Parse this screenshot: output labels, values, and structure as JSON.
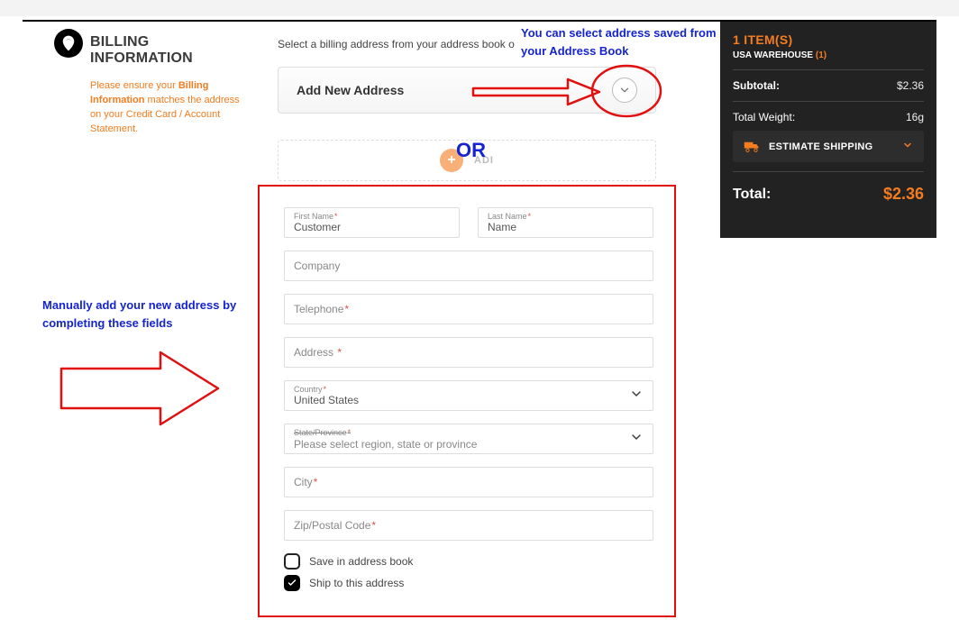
{
  "billing": {
    "heading": "BILLING INFORMATION",
    "hint_pre": "Please ensure your ",
    "hint_bold": "Billing Information",
    "hint_post": " matches the address on your Credit Card / Account Statement."
  },
  "select_text": "Select a billing address from your address book o",
  "dropdown": {
    "label": "Add New Address"
  },
  "adi_label": "ADI",
  "form": {
    "first_name": {
      "label": "First Name",
      "value": "Customer"
    },
    "last_name": {
      "label": "Last Name",
      "value": "Name"
    },
    "company": {
      "placeholder": "Company"
    },
    "telephone": {
      "placeholder": "Telephone"
    },
    "address": {
      "placeholder": "Address"
    },
    "country": {
      "label": "Country",
      "value": "United States"
    },
    "state": {
      "label": "State/Province",
      "placeholder": "Please select region, state or province"
    },
    "city": {
      "placeholder": "City"
    },
    "zip": {
      "placeholder": "Zip/Postal Code"
    },
    "save_label": "Save in address book",
    "ship_label": "Ship to this address"
  },
  "summary": {
    "items": "1 ITEM(S)",
    "warehouse_label": "USA WAREHOUSE",
    "warehouse_count": "(1)",
    "subtotal_label": "Subtotal:",
    "subtotal_value": "$2.36",
    "weight_label": "Total Weight:",
    "weight_value": "16g",
    "shipping_label": "ESTIMATE SHIPPING",
    "total_label": "Total:",
    "total_value": "$2.36"
  },
  "annotations": {
    "top": "You can select address saved from your Address Book",
    "or": "OR",
    "left": "Manually add your new address by completing these fields"
  }
}
